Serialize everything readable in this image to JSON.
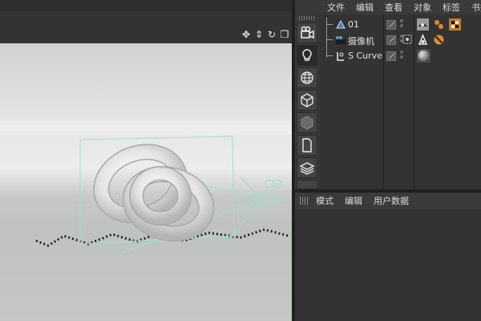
{
  "object_manager": {
    "menu": [
      "文件",
      "编辑",
      "查看",
      "对象",
      "标签",
      "书签"
    ],
    "objects": [
      {
        "name": "01",
        "icon": "spline-object-icon"
      },
      {
        "name": "摄像机",
        "icon": "camera-object-icon"
      },
      {
        "name": "S Curve",
        "icon": "lathe-object-icon"
      }
    ]
  },
  "attributes": {
    "menu": [
      "模式",
      "编辑",
      "用户数据"
    ]
  },
  "toolbar_icons": [
    "camera-icon",
    "light-icon",
    "sphere-grid-icon",
    "cube-wire-icon",
    "cube-solid-icon",
    "document-icon",
    "layers-icon"
  ],
  "colors": {
    "panel_bg": "#333333",
    "viewport_bg": "#dcdcdc",
    "guide_line": "#8fe8c8"
  }
}
